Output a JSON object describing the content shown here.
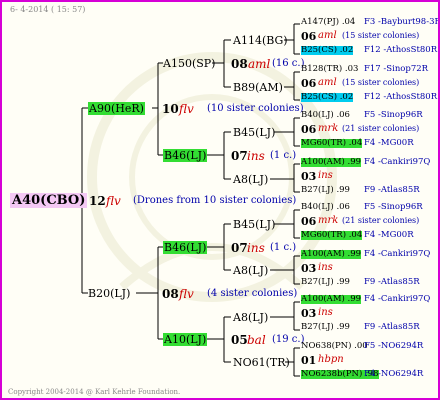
{
  "header": "6-  4-2014 ( 15: 57)",
  "footer": "Copyright 2004-2014 @ Karl Kehrle Foundation.",
  "root": {
    "label": "A40(CBO)",
    "num": "12",
    "mark": "flv",
    "note": "(Drones from 10 sister colonies)"
  },
  "g1": [
    {
      "label": "A90(HeR)",
      "num": "10",
      "mark": "flv",
      "note": "(10 sister colonies)"
    },
    {
      "label": "B20(LJ)",
      "num": "08",
      "mark": "flv",
      "note": "(4 sister colonies)"
    }
  ],
  "g2": [
    {
      "label": "A150(SP)",
      "num": "08",
      "mark": "aml",
      "note": "(16 c.)"
    },
    {
      "label": "B46(LJ)",
      "num": "07",
      "mark": "ins",
      "note": "(1 c.)"
    },
    {
      "label": "B46(LJ)",
      "num": "07",
      "mark": "ins",
      "note": "(1 c.)"
    },
    {
      "label": "A10(LJ)",
      "num": "05",
      "mark": "bal",
      "note": "(19 c.)"
    }
  ],
  "g3": [
    {
      "label": "A114(BG)"
    },
    {
      "label": "B89(AM)"
    },
    {
      "label": "B45(LJ)"
    },
    {
      "label": "A8(LJ)"
    },
    {
      "label": "B45(LJ)"
    },
    {
      "label": "A8(LJ)"
    },
    {
      "label": "A8(LJ)"
    },
    {
      "label": "NO61(TR)"
    }
  ],
  "g4": [
    {
      "a": "A147(PJ) .04",
      "ar": "F3 -Bayburt98-3R",
      "m": "06",
      "mk": "aml",
      "mn": "(15 sister colonies)",
      "b": "B25(CS) .02",
      "br": "F12 -AthosSt80R"
    },
    {
      "a": "B128(TR) .03",
      "ar": "F17 -Sinop72R",
      "m": "06",
      "mk": "aml",
      "mn": "(15 sister colonies)",
      "b": "B25(CS) .02",
      "br": "F12 -AthosSt80R"
    },
    {
      "a": "B40(LJ) .06",
      "ar": "F5 -Sinop96R",
      "m": "06",
      "mk": "mrk",
      "mn": "(21 sister colonies)",
      "b": "MG60(TR) .04",
      "br": "F4 -MG00R"
    },
    {
      "a": "A100(AM) .99",
      "ar": "F4 -Cankiri97Q",
      "m": "03",
      "mk": "ins",
      "mn": "",
      "b": "B27(LJ) .99",
      "br": "F9 -Atlas85R"
    },
    {
      "a": "B40(LJ) .06",
      "ar": "F5 -Sinop96R",
      "m": "06",
      "mk": "mrk",
      "mn": "(21 sister colonies)",
      "b": "MG60(TR) .04",
      "br": "F4 -MG00R"
    },
    {
      "a": "A100(AM) .99",
      "ar": "F4 -Cankiri97Q",
      "m": "03",
      "mk": "ins",
      "mn": "",
      "b": "B27(LJ) .99",
      "br": "F9 -Atlas85R"
    },
    {
      "a": "A100(AM) .99",
      "ar": "F4 -Cankiri97Q",
      "m": "03",
      "mk": "ins",
      "mn": "",
      "b": "B27(LJ) .99",
      "br": "F9 -Atlas85R"
    },
    {
      "a": "NO638(PN) .00",
      "ar": "F5 -NO6294R",
      "m": "01",
      "mk": "hbpn",
      "mn": "",
      "b": "NO6238b(PN) .98",
      "br": "F4 -NO6294R"
    }
  ]
}
